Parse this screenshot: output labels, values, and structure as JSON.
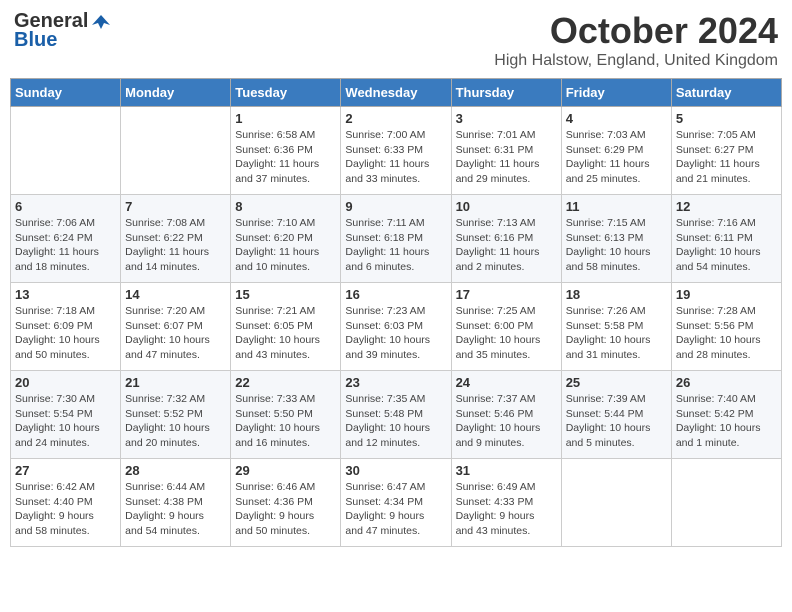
{
  "header": {
    "logo_general": "General",
    "logo_blue": "Blue",
    "month": "October 2024",
    "location": "High Halstow, England, United Kingdom"
  },
  "weekdays": [
    "Sunday",
    "Monday",
    "Tuesday",
    "Wednesday",
    "Thursday",
    "Friday",
    "Saturday"
  ],
  "weeks": [
    [
      {
        "day": "",
        "info": ""
      },
      {
        "day": "",
        "info": ""
      },
      {
        "day": "1",
        "info": "Sunrise: 6:58 AM\nSunset: 6:36 PM\nDaylight: 11 hours\nand 37 minutes."
      },
      {
        "day": "2",
        "info": "Sunrise: 7:00 AM\nSunset: 6:33 PM\nDaylight: 11 hours\nand 33 minutes."
      },
      {
        "day": "3",
        "info": "Sunrise: 7:01 AM\nSunset: 6:31 PM\nDaylight: 11 hours\nand 29 minutes."
      },
      {
        "day": "4",
        "info": "Sunrise: 7:03 AM\nSunset: 6:29 PM\nDaylight: 11 hours\nand 25 minutes."
      },
      {
        "day": "5",
        "info": "Sunrise: 7:05 AM\nSunset: 6:27 PM\nDaylight: 11 hours\nand 21 minutes."
      }
    ],
    [
      {
        "day": "6",
        "info": "Sunrise: 7:06 AM\nSunset: 6:24 PM\nDaylight: 11 hours\nand 18 minutes."
      },
      {
        "day": "7",
        "info": "Sunrise: 7:08 AM\nSunset: 6:22 PM\nDaylight: 11 hours\nand 14 minutes."
      },
      {
        "day": "8",
        "info": "Sunrise: 7:10 AM\nSunset: 6:20 PM\nDaylight: 11 hours\nand 10 minutes."
      },
      {
        "day": "9",
        "info": "Sunrise: 7:11 AM\nSunset: 6:18 PM\nDaylight: 11 hours\nand 6 minutes."
      },
      {
        "day": "10",
        "info": "Sunrise: 7:13 AM\nSunset: 6:16 PM\nDaylight: 11 hours\nand 2 minutes."
      },
      {
        "day": "11",
        "info": "Sunrise: 7:15 AM\nSunset: 6:13 PM\nDaylight: 10 hours\nand 58 minutes."
      },
      {
        "day": "12",
        "info": "Sunrise: 7:16 AM\nSunset: 6:11 PM\nDaylight: 10 hours\nand 54 minutes."
      }
    ],
    [
      {
        "day": "13",
        "info": "Sunrise: 7:18 AM\nSunset: 6:09 PM\nDaylight: 10 hours\nand 50 minutes."
      },
      {
        "day": "14",
        "info": "Sunrise: 7:20 AM\nSunset: 6:07 PM\nDaylight: 10 hours\nand 47 minutes."
      },
      {
        "day": "15",
        "info": "Sunrise: 7:21 AM\nSunset: 6:05 PM\nDaylight: 10 hours\nand 43 minutes."
      },
      {
        "day": "16",
        "info": "Sunrise: 7:23 AM\nSunset: 6:03 PM\nDaylight: 10 hours\nand 39 minutes."
      },
      {
        "day": "17",
        "info": "Sunrise: 7:25 AM\nSunset: 6:00 PM\nDaylight: 10 hours\nand 35 minutes."
      },
      {
        "day": "18",
        "info": "Sunrise: 7:26 AM\nSunset: 5:58 PM\nDaylight: 10 hours\nand 31 minutes."
      },
      {
        "day": "19",
        "info": "Sunrise: 7:28 AM\nSunset: 5:56 PM\nDaylight: 10 hours\nand 28 minutes."
      }
    ],
    [
      {
        "day": "20",
        "info": "Sunrise: 7:30 AM\nSunset: 5:54 PM\nDaylight: 10 hours\nand 24 minutes."
      },
      {
        "day": "21",
        "info": "Sunrise: 7:32 AM\nSunset: 5:52 PM\nDaylight: 10 hours\nand 20 minutes."
      },
      {
        "day": "22",
        "info": "Sunrise: 7:33 AM\nSunset: 5:50 PM\nDaylight: 10 hours\nand 16 minutes."
      },
      {
        "day": "23",
        "info": "Sunrise: 7:35 AM\nSunset: 5:48 PM\nDaylight: 10 hours\nand 12 minutes."
      },
      {
        "day": "24",
        "info": "Sunrise: 7:37 AM\nSunset: 5:46 PM\nDaylight: 10 hours\nand 9 minutes."
      },
      {
        "day": "25",
        "info": "Sunrise: 7:39 AM\nSunset: 5:44 PM\nDaylight: 10 hours\nand 5 minutes."
      },
      {
        "day": "26",
        "info": "Sunrise: 7:40 AM\nSunset: 5:42 PM\nDaylight: 10 hours\nand 1 minute."
      }
    ],
    [
      {
        "day": "27",
        "info": "Sunrise: 6:42 AM\nSunset: 4:40 PM\nDaylight: 9 hours\nand 58 minutes."
      },
      {
        "day": "28",
        "info": "Sunrise: 6:44 AM\nSunset: 4:38 PM\nDaylight: 9 hours\nand 54 minutes."
      },
      {
        "day": "29",
        "info": "Sunrise: 6:46 AM\nSunset: 4:36 PM\nDaylight: 9 hours\nand 50 minutes."
      },
      {
        "day": "30",
        "info": "Sunrise: 6:47 AM\nSunset: 4:34 PM\nDaylight: 9 hours\nand 47 minutes."
      },
      {
        "day": "31",
        "info": "Sunrise: 6:49 AM\nSunset: 4:33 PM\nDaylight: 9 hours\nand 43 minutes."
      },
      {
        "day": "",
        "info": ""
      },
      {
        "day": "",
        "info": ""
      }
    ]
  ]
}
